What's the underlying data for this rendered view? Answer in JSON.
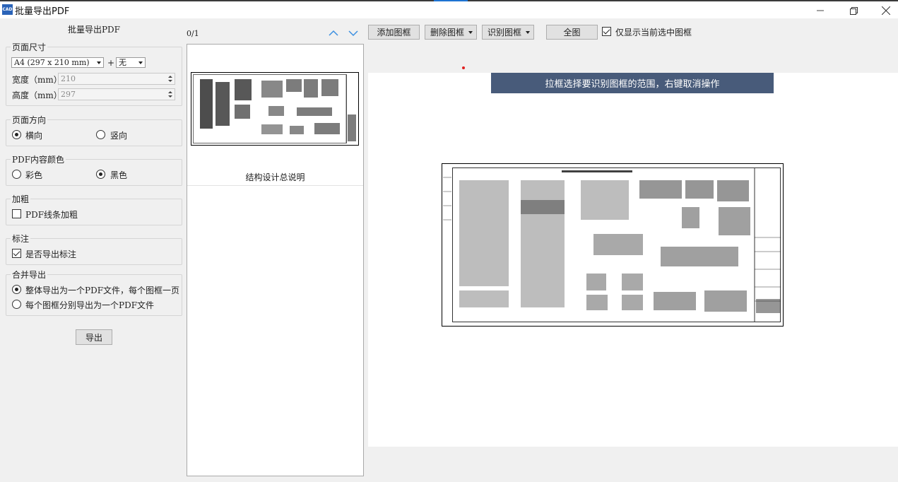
{
  "window": {
    "icon_text": "CAD",
    "title": "批量导出PDF"
  },
  "left_panel": {
    "title": "批量导出PDF",
    "page_size": {
      "legend": "页面尺寸",
      "size_value": "A4 (297 x 210 mm)",
      "plus": "+",
      "extra_value": "无",
      "width_label": "宽度（mm）",
      "width_value": "210",
      "height_label": "高度（mm）",
      "height_value": "297"
    },
    "orientation": {
      "legend": "页面方向",
      "landscape": "横向",
      "portrait": "竖向",
      "selected": "landscape"
    },
    "color": {
      "legend": "PDF内容颜色",
      "color_option": "彩色",
      "black_option": "黑色",
      "selected": "black"
    },
    "bold": {
      "legend": "加粗",
      "checkbox_label": "PDF线条加粗",
      "checked": false
    },
    "annotation": {
      "legend": "标注",
      "checkbox_label": "是否导出标注",
      "checked": true
    },
    "merge": {
      "legend": "合并导出",
      "option_single": "整体导出为一个PDF文件，每个图框一页",
      "option_each": "每个图框分别导出为一个PDF文件",
      "selected": "single"
    },
    "export_button": "导出"
  },
  "middle_panel": {
    "page_counter": "0/1",
    "thumbnails": [
      {
        "caption": "结构设计总说明"
      }
    ]
  },
  "toolbar": {
    "add_frame": "添加图框",
    "delete_frame": "删除图框",
    "recognize_frame": "识别图框",
    "full_view": "全图",
    "only_selected_label": "仅显示当前选中图框",
    "only_selected_checked": true
  },
  "canvas": {
    "banner_text": "拉框选择要识别图框的范围，右键取消操作"
  },
  "colors": {
    "banner_bg": "#485b7a",
    "accent_blue": "#1e73d2",
    "marker_red": "#e02020"
  }
}
